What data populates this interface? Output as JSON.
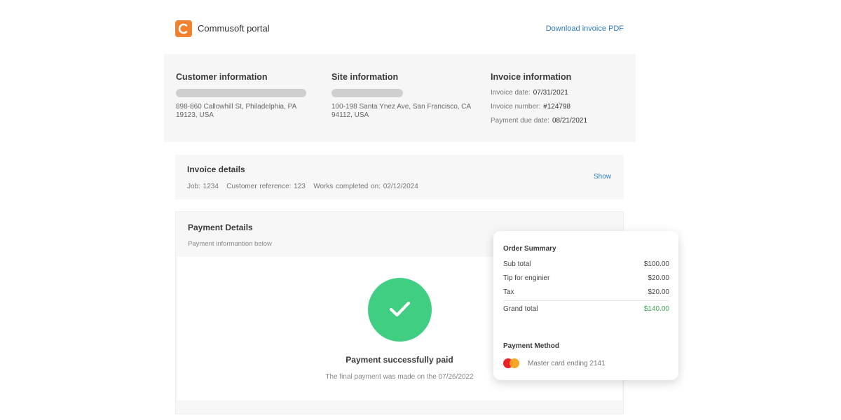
{
  "header": {
    "portal_title": "Commusoft portal",
    "download_label": "Download invoice PDF",
    "logo_color": "#f0812e"
  },
  "customer": {
    "heading": "Customer information",
    "address_line1": "898-860 Callowhill St, Philadelphia, PA",
    "address_line2": "19123, USA"
  },
  "site": {
    "heading": "Site information",
    "address_line1": "100-198 Santa Ynez Ave, San Francisco, CA",
    "address_line2": "94112, USA"
  },
  "invoice_info": {
    "heading": "Invoice information",
    "date_label": "Invoice date:",
    "date_value": "07/31/2021",
    "number_label": "Invoice number:",
    "number_value": "#124798",
    "due_label": "Payment due date:",
    "due_value": "08/21/2021"
  },
  "invoice_details": {
    "title": "Invoice details",
    "meta": "Job: 1234   Customer reference: 123   Works completed on: 02/12/2024",
    "show_label": "Show"
  },
  "payment": {
    "title": "Payment Details",
    "subtitle": "Payment informantion below",
    "success_title": "Payment successfully paid",
    "success_sub": "The final payment was made on the 07/26/2022",
    "success_color": "#3fce82"
  },
  "order_summary": {
    "title": "Order Summary",
    "rows": [
      {
        "label": "Sub total",
        "amount": "$100.00"
      },
      {
        "label": "Tip for enginier",
        "amount": "$20.00"
      },
      {
        "label": "Tax",
        "amount": "$20.00"
      }
    ],
    "grand_label": "Grand total",
    "grand_amount": "$140.00",
    "method_title": "Payment Method",
    "method_text": "Master card ending 2141"
  }
}
